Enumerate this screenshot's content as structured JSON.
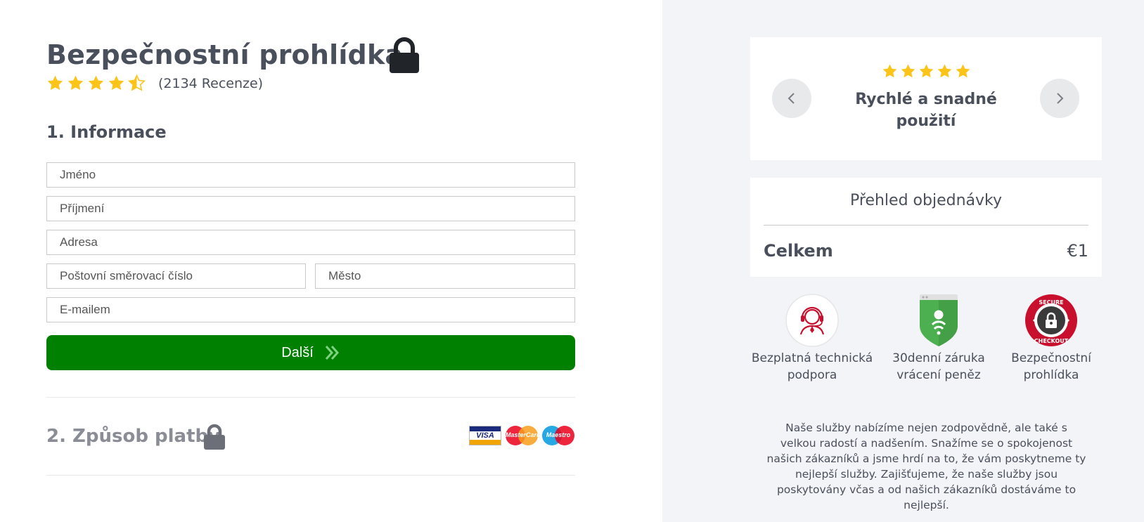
{
  "checkout": {
    "title": "Bezpečnostní prohlídka",
    "rating": {
      "stars": 4.5,
      "count_text": "(2134 Recenze)"
    },
    "section1_title": "1. Informace",
    "fields": {
      "first_name": "Jméno",
      "last_name": "Příjmení",
      "address": "Adresa",
      "zip": "Poštovní směrovací číslo",
      "city": "Město",
      "email": "E-mailem"
    },
    "next_button": "Další",
    "section2_title": "2. Způsob platby",
    "payment_cards": [
      "VISA",
      "MasterCard",
      "Maestro"
    ]
  },
  "review": {
    "stars": 5,
    "text": "Rychlé a snadné použití"
  },
  "summary": {
    "title": "Přehled objednávky",
    "total_label": "Celkem",
    "total_value": "€1"
  },
  "badges": [
    {
      "icon": "support-agent-icon",
      "label": "Bezplatná technická podpora"
    },
    {
      "icon": "money-back-shield-icon",
      "label": "30denní záruka vrácení peněz"
    },
    {
      "icon": "secure-checkout-seal-icon",
      "label": "Bezpečnostní prohlídka",
      "seal_text_top": "SECURE",
      "seal_text_bottom": "CHECKOUT"
    }
  ],
  "about_text": "Naše služby nabízíme nejen zodpovědně, ale také s velkou radostí a nadšením. Snažíme se o spokojenost našich zákazníků a jsme hrdí na to, že vám poskytneme ty nejlepší služby. Zajišťujeme, že naše služby jsou poskytovány včas a od našich zákazníků dostáváme to nejlepší.",
  "colors": {
    "accent_green": "#008000",
    "star_gold": "#fcc419",
    "text_dark": "#4a4f5c",
    "sidebar_bg": "#f3f4f7"
  }
}
